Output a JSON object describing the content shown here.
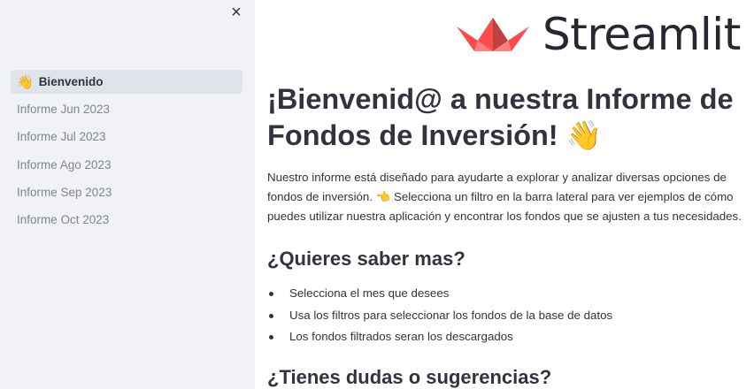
{
  "sidebar": {
    "close_icon": "×",
    "items": [
      {
        "emoji": "👋",
        "label": "Bienvenido",
        "active": true
      },
      {
        "label": "Informe Jun 2023"
      },
      {
        "label": "Informe Jul 2023"
      },
      {
        "label": "Informe Ago 2023"
      },
      {
        "label": "Informe Sep 2023"
      },
      {
        "label": "Informe Oct 2023"
      }
    ]
  },
  "header": {
    "logo_text": "Streamlit",
    "logo_icon": "streamlit-crown-icon",
    "logo_colors": [
      "#ff4b4b",
      "#bd4043",
      "#ff8080"
    ]
  },
  "main": {
    "title": "¡Bienvenid@ a nuestra Informe de Fondos de Inversión! 👋",
    "intro": "Nuestro informe está diseñado para ayudarte a explorar y analizar diversas opciones de fondos de inversión. 👈 Selecciona un filtro en la barra lateral para ver ejemplos de cómo puedes utilizar nuestra aplicación y encontrar los fondos que se ajusten a tus necesidades.",
    "section1_title": "¿Quieres saber mas?",
    "bullets": [
      "Selecciona el mes que desees",
      "Usa los filtros para seleccionar los fondos de la base de datos",
      "Los fondos filtrados seran los descargados"
    ],
    "section2_title": "¿Tienes dudas o sugerencias?"
  }
}
